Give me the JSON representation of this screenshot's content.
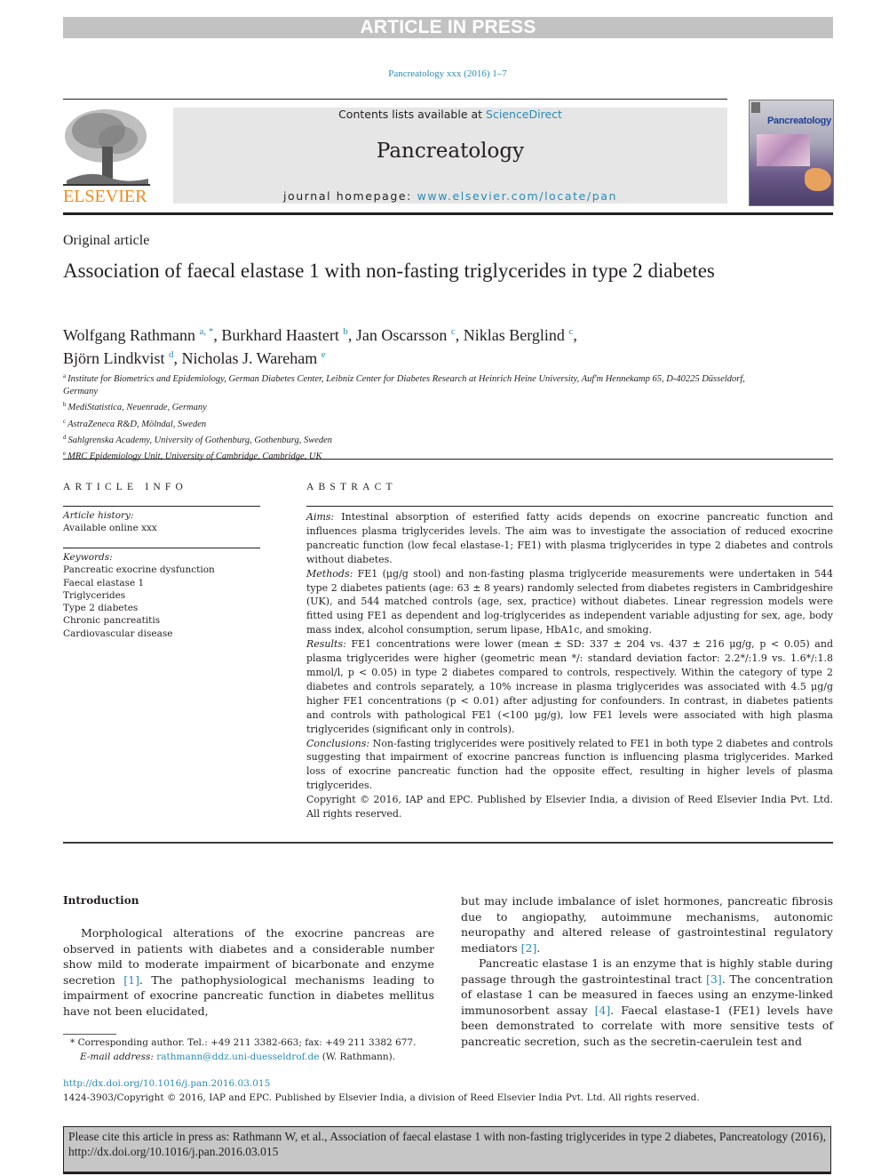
{
  "banner": {
    "text": "ARTICLE IN PRESS"
  },
  "journal_ref": "Pancreatology xxx (2016) 1–7",
  "header": {
    "publisher_logo_text": "ELSEVIER",
    "contents_prefix": "Contents lists available at ",
    "contents_link": "ScienceDirect",
    "journal_title": "Pancreatology",
    "homepage_prefix": "journal homepage: ",
    "homepage_link": "www.elsevier.com/locate/pan",
    "cover_title": "Pancreatology"
  },
  "article": {
    "type": "Original article",
    "title": "Association of faecal elastase 1 with non-fasting triglycerides in type 2 diabetes",
    "authors": [
      {
        "name": "Wolfgang Rathmann",
        "sup": "a, *"
      },
      {
        "name": "Burkhard Haastert",
        "sup": "b"
      },
      {
        "name": "Jan Oscarsson",
        "sup": "c"
      },
      {
        "name": "Niklas Berglind",
        "sup": "c"
      },
      {
        "name": "Björn Lindkvist",
        "sup": "d"
      },
      {
        "name": "Nicholas J. Wareham",
        "sup": "e"
      }
    ],
    "affiliations": [
      {
        "key": "a",
        "text": "Institute for Biometrics and Epidemiology, German Diabetes Center, Leibniz Center for Diabetes Research at Heinrich Heine University, Auf'm Hennekamp 65, D-40225 Düsseldorf, Germany"
      },
      {
        "key": "b",
        "text": "MediStatistica, Neuenrade, Germany"
      },
      {
        "key": "c",
        "text": "AstraZeneca R&D, Mölndal, Sweden"
      },
      {
        "key": "d",
        "text": "Sahlgrenska Academy, University of Gothenburg, Gothenburg, Sweden"
      },
      {
        "key": "e",
        "text": "MRC Epidemiology Unit, University of Cambridge, Cambridge, UK"
      }
    ]
  },
  "article_info": {
    "heading": "ARTICLE INFO",
    "history_label": "Article history:",
    "history_value": "Available online xxx",
    "keywords_label": "Keywords:",
    "keywords": [
      "Pancreatic exocrine dysfunction",
      "Faecal elastase 1",
      "Triglycerides",
      "Type 2 diabetes",
      "Chronic pancreatitis",
      "Cardiovascular disease"
    ]
  },
  "abstract": {
    "heading": "ABSTRACT",
    "sections": [
      {
        "label": "Aims:",
        "text": " Intestinal absorption of esterified fatty acids depends on exocrine pancreatic function and influences plasma triglycerides levels. The aim was to investigate the association of reduced exocrine pancreatic function (low fecal elastase-1; FE1) with plasma triglycerides in type 2 diabetes and controls without diabetes."
      },
      {
        "label": "Methods:",
        "text": " FE1 (μg/g stool) and non-fasting plasma triglyceride measurements were undertaken in 544 type 2 diabetes patients (age: 63 ± 8 years) randomly selected from diabetes registers in Cambridgeshire (UK), and 544 matched controls (age, sex, practice) without diabetes. Linear regression models were fitted using FE1 as dependent and log-triglycerides as independent variable adjusting for sex, age, body mass index, alcohol consumption, serum lipase, HbA1c, and smoking."
      },
      {
        "label": "Results:",
        "text": " FE1 concentrations were lower (mean ± SD: 337 ± 204 vs. 437 ± 216 μg/g, p < 0.05) and plasma triglycerides were higher (geometric mean */: standard deviation factor: 2.2*/:1.9 vs. 1.6*/:1.8 mmol/l, p < 0.05) in type 2 diabetes compared to controls, respectively. Within the category of type 2 diabetes and controls separately, a 10% increase in plasma triglycerides was associated with 4.5 μg/g higher FE1 concentrations (p < 0.01) after adjusting for confounders. In contrast, in diabetes patients and controls with pathological FE1 (<100 μg/g), low FE1 levels were associated with high plasma triglycerides (significant only in controls)."
      },
      {
        "label": "Conclusions:",
        "text": " Non-fasting triglycerides were positively related to FE1 in both type 2 diabetes and controls suggesting that impairment of exocrine pancreas function is influencing plasma triglycerides. Marked loss of exocrine pancreatic function had the opposite effect, resulting in higher levels of plasma triglycerides."
      }
    ],
    "copyright": "Copyright © 2016, IAP and EPC. Published by Elsevier India, a division of Reed Elsevier India Pvt. Ltd. All rights reserved."
  },
  "body": {
    "intro_heading": "Introduction",
    "left_p1_a": "Morphological alterations of the exocrine pancreas are observed in patients with diabetes and a considerable number show mild to moderate impairment of bicarbonate and enzyme secretion ",
    "left_p1_ref1": "[1]",
    "left_p1_b": ". The pathophysiological mechanisms leading to impairment of exocrine pancreatic function in diabetes mellitus have not been elucidated,",
    "right_p1_a": "but may include imbalance of islet hormones, pancreatic fibrosis due to angiopathy, autoimmune mechanisms, autonomic neuropathy and altered release of gastrointestinal regulatory mediators ",
    "right_p1_ref2": "[2]",
    "right_p1_b": ".",
    "right_p2_a": "Pancreatic elastase 1 is an enzyme that is highly stable during passage through the gastrointestinal tract ",
    "right_p2_ref3": "[3]",
    "right_p2_b": ". The concentration of elastase 1 can be measured in faeces using an enzyme-linked immunosorbent assay ",
    "right_p2_ref4": "[4]",
    "right_p2_c": ". Faecal elastase-1 (FE1) levels have been demonstrated to correlate with more sensitive tests of pancreatic secretion, such as the secretin-caerulein test and"
  },
  "footnote": {
    "star_text": "* Corresponding author. Tel.: +49 211 3382-663; fax: +49 211 3382 677.",
    "email_label": "E-mail address:",
    "email": "rathmann@ddz.uni-duesseldrof.de",
    "email_suffix": " (W. Rathmann)."
  },
  "doi": {
    "link": "http://dx.doi.org/10.1016/j.pan.2016.03.015",
    "issn_copyright": "1424-3903/Copyright © 2016, IAP and EPC. Published by Elsevier India, a division of Reed Elsevier India Pvt. Ltd. All rights reserved."
  },
  "cite_box": {
    "text": "Please cite this article in press as: Rathmann W, et al., Association of faecal elastase 1 with non-fasting triglycerides in type 2 diabetes, Pancreatology (2016), http://dx.doi.org/10.1016/j.pan.2016.03.015"
  }
}
